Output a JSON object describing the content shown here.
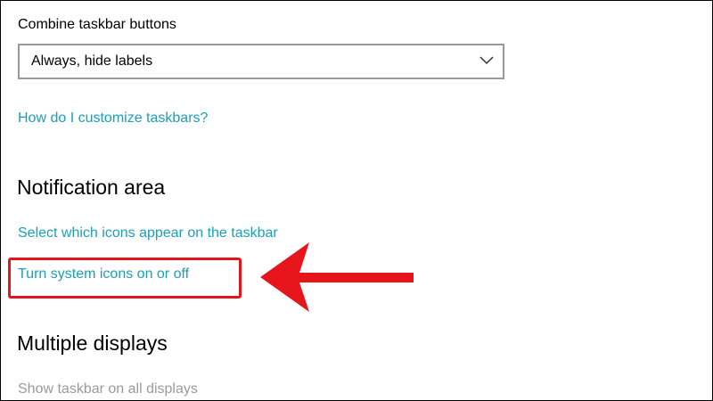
{
  "taskbar": {
    "combine_label": "Combine taskbar buttons",
    "combine_value": "Always, hide labels",
    "customize_link": "How do I customize taskbars?"
  },
  "notification_area": {
    "heading": "Notification area",
    "select_icons_link": "Select which icons appear on the taskbar",
    "system_icons_link": "Turn system icons on or off"
  },
  "multiple_displays": {
    "heading": "Multiple displays",
    "show_taskbar_all": "Show taskbar on all displays"
  },
  "colors": {
    "link": "#1a9fb5",
    "annotation": "#e8141c",
    "disabled": "#9a9a9a",
    "dropdown_border": "#999999"
  },
  "icons": {
    "dropdown": "chevron-down-icon",
    "annotation": "arrow-left-icon"
  }
}
